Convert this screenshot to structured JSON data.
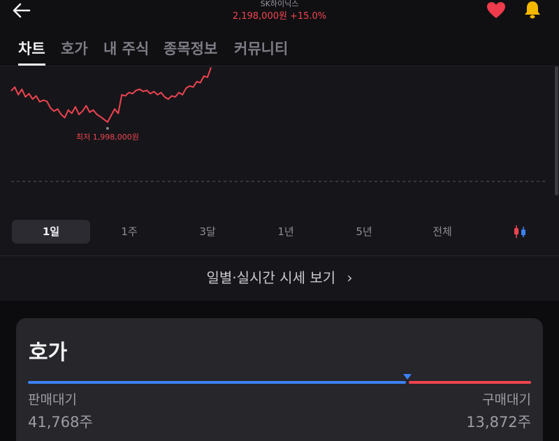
{
  "header": {
    "stock_name": "SK하이닉스",
    "price": "2,198,000원",
    "change": "+15.0%",
    "icons": {
      "back": "back-arrow-icon",
      "favorite": "heart-icon",
      "alert": "bell-icon"
    },
    "colors": {
      "up": "#f0454f",
      "heart": "#ef3b4b",
      "bell": "#f5b800"
    }
  },
  "tabs": [
    {
      "label": "차트",
      "active": true
    },
    {
      "label": "호가",
      "active": false
    },
    {
      "label": "내 주식",
      "active": false
    },
    {
      "label": "종목정보",
      "active": false
    },
    {
      "label": "커뮤니티",
      "active": false
    }
  ],
  "chart_data": {
    "type": "line",
    "color": "#ef4450",
    "low_label": "최저 1,998,000원",
    "values": [
      2055000,
      2062000,
      2048000,
      2058000,
      2044000,
      2050000,
      2040000,
      2046000,
      2035000,
      2038000,
      2036000,
      2024000,
      2018000,
      2022000,
      2012000,
      2006000,
      2020000,
      2014000,
      2026000,
      2012000,
      2018000,
      2028000,
      2016000,
      2020000,
      2012000,
      2008000,
      2003000,
      1998000,
      2010000,
      2022000,
      2014000,
      2048000,
      2046000,
      2052000,
      2050000,
      2056000,
      2058000,
      2054000,
      2056000,
      2050000,
      2054000,
      2048000,
      2052000,
      2044000,
      2040000,
      2046000,
      2044000,
      2052000,
      2048000,
      2060000,
      2064000,
      2062000,
      2072000,
      2070000,
      2082000,
      2080000,
      2098000
    ],
    "baseline_dashed": true
  },
  "periods": [
    {
      "label": "1일",
      "active": true
    },
    {
      "label": "1주",
      "active": false
    },
    {
      "label": "3달",
      "active": false
    },
    {
      "label": "1년",
      "active": false
    },
    {
      "label": "5년",
      "active": false
    },
    {
      "label": "전체",
      "active": false
    }
  ],
  "chart_type_icon": "candlestick-icon",
  "daily_link": {
    "label": "일별·실시간 시세 보기",
    "chevron": "›"
  },
  "orderbook": {
    "title": "호가",
    "sell_label": "판매대기",
    "buy_label": "구매대기",
    "sell_qty": "41,768주",
    "buy_qty": "13,872주",
    "sell_ratio": 0.751,
    "colors": {
      "sell": "#3b82f6",
      "buy": "#ef4450"
    }
  }
}
